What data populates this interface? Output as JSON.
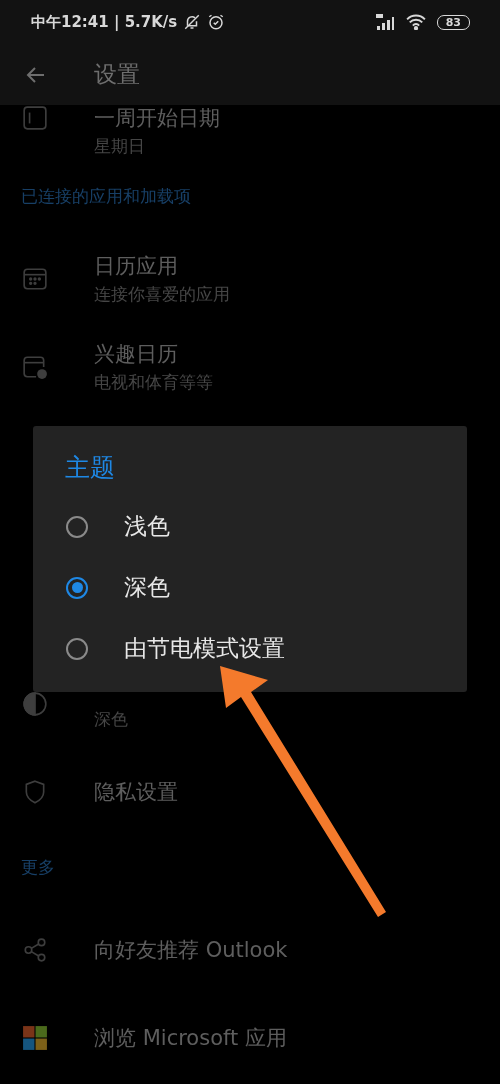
{
  "status_bar": {
    "time_speed": "中午12:41 | 5.7K/s",
    "battery": "83"
  },
  "header": {
    "title": "设置"
  },
  "settings_above_dialog": [
    {
      "kind": "row",
      "title": "一周开始日期",
      "subtitle": "星期日"
    },
    {
      "kind": "section",
      "title": "已连接的应用和加载项"
    },
    {
      "kind": "row",
      "title": "日历应用",
      "subtitle": "连接你喜爱的应用"
    },
    {
      "kind": "row",
      "title": "兴趣日历",
      "subtitle": "电视和体育等等"
    }
  ],
  "settings_below_dialog": [
    {
      "kind": "row",
      "subtitle": "深色"
    },
    {
      "kind": "row",
      "title": "隐私设置"
    },
    {
      "kind": "section",
      "title": "更多"
    },
    {
      "kind": "row",
      "title": "向好友推荐 Outlook"
    },
    {
      "kind": "row",
      "title": "浏览 Microsoft 应用"
    }
  ],
  "dialog": {
    "title": "主题",
    "options": [
      {
        "label": "浅色",
        "selected": false
      },
      {
        "label": "深色",
        "selected": true
      },
      {
        "label": "由节电模式设置",
        "selected": false
      }
    ]
  }
}
